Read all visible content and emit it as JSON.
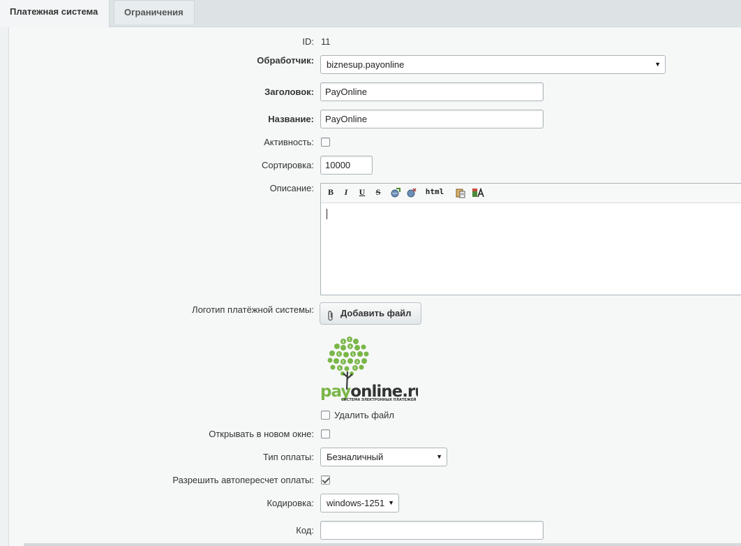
{
  "tabs": [
    {
      "label": "Платежная система",
      "active": true
    },
    {
      "label": "Ограничения",
      "active": false
    }
  ],
  "form": {
    "id": {
      "label": "ID:",
      "value": "11"
    },
    "handler": {
      "label": "Обработчик:",
      "value": "biznesup.payonline"
    },
    "title": {
      "label": "Заголовок:",
      "value": "PayOnline"
    },
    "name": {
      "label": "Название:",
      "value": "PayOnline"
    },
    "active": {
      "label": "Активность:",
      "checked": false
    },
    "sort": {
      "label": "Сортировка:",
      "value": "10000"
    },
    "description": {
      "label": "Описание:",
      "toolbar": {
        "bold": "B",
        "italic": "I",
        "underline": "U",
        "strike": "S",
        "html": "html"
      },
      "value": ""
    },
    "logo": {
      "label": "Логотип платёжной системы:",
      "add_file_label": "Добавить файл",
      "logo_text": "payonline.ru",
      "logo_subtext": "СИСТЕМА ЭЛЕКТРОННЫХ ПЛАТЕЖЕЙ",
      "delete_file_label": "Удалить файл",
      "delete_checked": false
    },
    "new_window": {
      "label": "Открывать в новом окне:",
      "checked": false
    },
    "payment_type": {
      "label": "Тип оплаты:",
      "value": "Безналичный"
    },
    "auto_recalc": {
      "label": "Разрешить автопересчет оплаты:",
      "checked": true
    },
    "encoding": {
      "label": "Кодировка:",
      "value": "windows-1251"
    },
    "code": {
      "label": "Код:",
      "value": ""
    }
  },
  "colors": {
    "logo_green": "#7ab648",
    "logo_dark": "#333333"
  }
}
